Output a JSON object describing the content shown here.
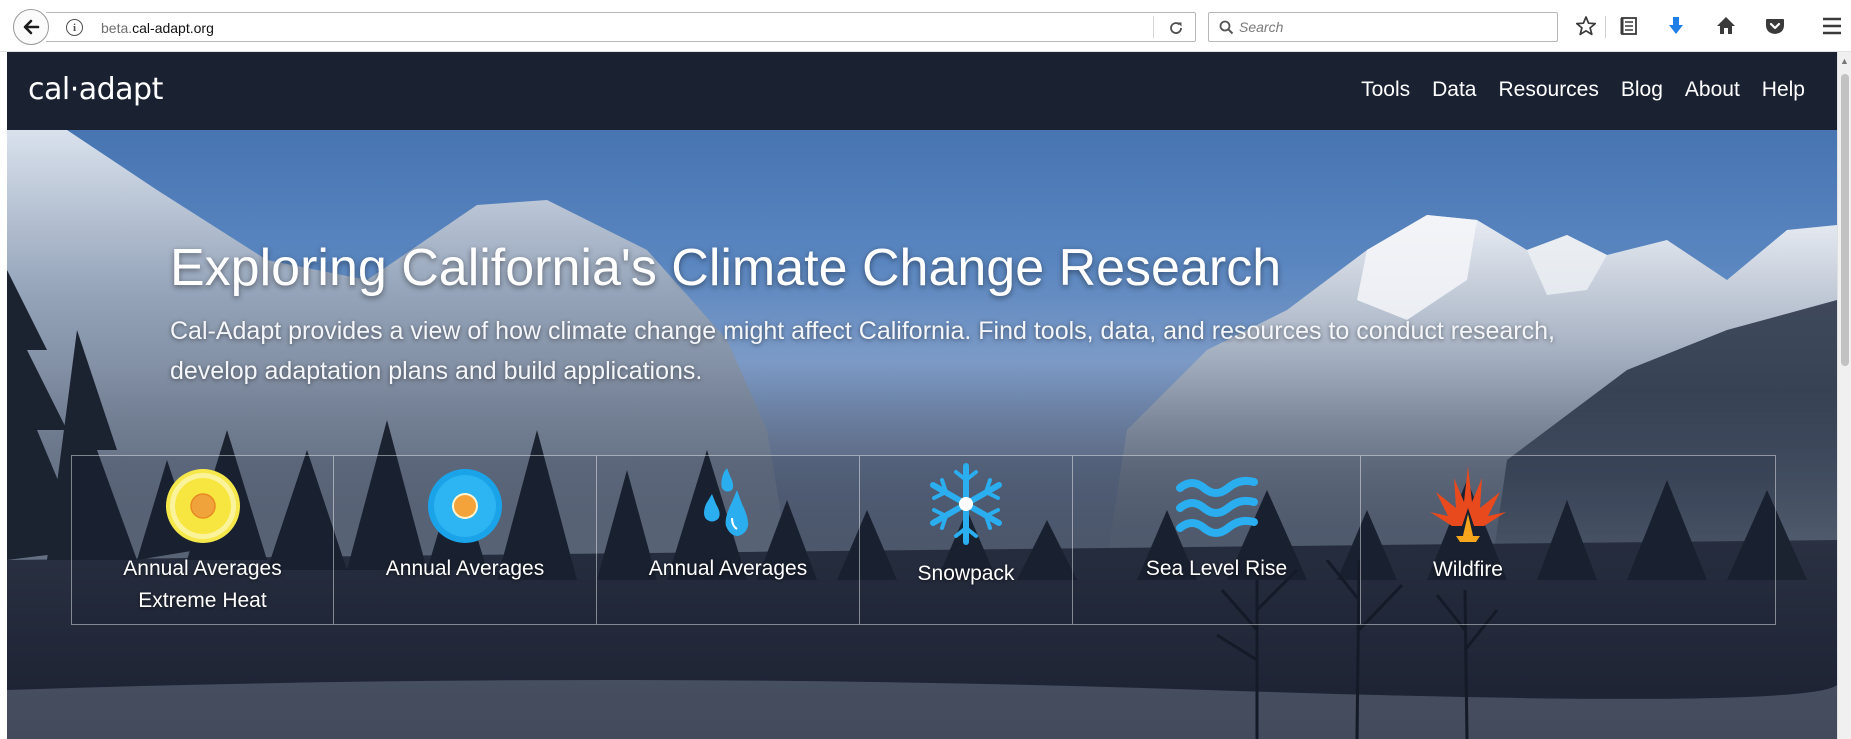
{
  "browser": {
    "url_subdomain": "beta.",
    "url_domain": "cal-adapt.org",
    "search_placeholder": "Search"
  },
  "site": {
    "logo": "cal·adapt",
    "nav": [
      "Tools",
      "Data",
      "Resources",
      "Blog",
      "About",
      "Help"
    ]
  },
  "hero": {
    "title": "Exploring California's Climate Change Research",
    "subtitle": "Cal-Adapt provides a view of how climate change might affect California. Find tools, data, and resources to conduct research, develop adaptation plans and build applications."
  },
  "tiles": [
    {
      "label_line1": "Annual Averages",
      "label_line2": "Extreme Heat",
      "icon": "sun-icon"
    },
    {
      "label_line1": "Annual Averages",
      "label_line2": "",
      "icon": "temperature-icon"
    },
    {
      "label_line1": "Annual Averages",
      "label_line2": "",
      "icon": "water-drops-icon"
    },
    {
      "label_line1": "Snowpack",
      "label_line2": "",
      "icon": "snowflake-icon"
    },
    {
      "label_line1": "Sea Level Rise",
      "label_line2": "",
      "icon": "waves-icon"
    },
    {
      "label_line1": "Wildfire",
      "label_line2": "",
      "icon": "fire-icon"
    }
  ],
  "colors": {
    "nav_bg": "#1a2131",
    "sun_yellow": "#f6e84a",
    "sun_center": "#f0a33a",
    "blue_icon": "#1aa3e8",
    "fire_red": "#e84a1e",
    "fire_orange": "#f5a61d"
  }
}
